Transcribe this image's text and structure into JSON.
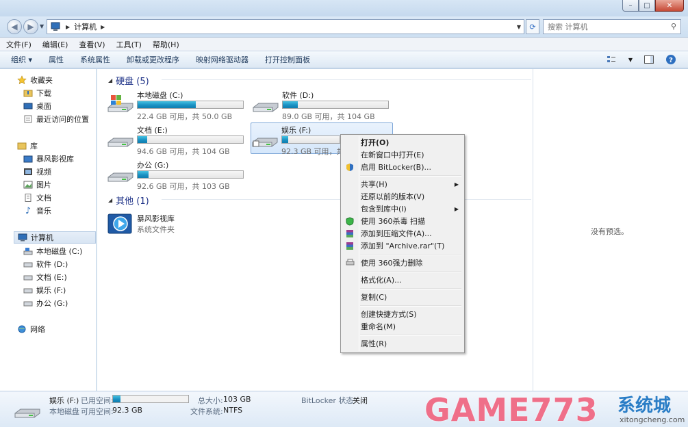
{
  "window": {
    "buttons": {
      "minimize": "–",
      "maximize": "□",
      "close": "✕"
    }
  },
  "address": {
    "crumb": "计算机",
    "search_placeholder": "搜索 计算机"
  },
  "menu": {
    "items": [
      "文件(F)",
      "编辑(E)",
      "查看(V)",
      "工具(T)",
      "帮助(H)"
    ]
  },
  "commands": {
    "organize": "组织 ▾",
    "items": [
      "属性",
      "系统属性",
      "卸载或更改程序",
      "映射网络驱动器",
      "打开控制面板"
    ]
  },
  "nav": {
    "favorites": "收藏夹",
    "favorites_items": [
      "下载",
      "桌面",
      "最近访问的位置"
    ],
    "libraries": "库",
    "library_items": [
      "暴风影视库",
      "视频",
      "图片",
      "文档",
      "音乐"
    ],
    "computer": "计算机",
    "computer_items": [
      "本地磁盘 (C:)",
      "软件 (D:)",
      "文档 (E:)",
      "娱乐 (F:)",
      "办公 (G:)"
    ],
    "network": "网络"
  },
  "content": {
    "group_drives": "硬盘 (5)",
    "group_other": "其他 (1)",
    "drives": [
      {
        "name": "本地磁盘 (C:)",
        "info": "22.4 GB 可用，共 50.0 GB",
        "used_fraction": 0.552
      },
      {
        "name": "软件 (D:)",
        "info": "89.0 GB 可用，共 104 GB",
        "used_fraction": 0.144
      },
      {
        "name": "文档 (E:)",
        "info": "94.6 GB 可用，共 104 GB",
        "used_fraction": 0.09
      },
      {
        "name": "娱乐 (F:)",
        "info": "92.3 GB 可用，共",
        "used_fraction": 0.104
      },
      {
        "name": "办公 (G:)",
        "info": "92.6 GB 可用，共 103 GB",
        "used_fraction": 0.101
      }
    ],
    "other": {
      "name": "暴风影视库",
      "desc": "系统文件夹"
    }
  },
  "context_menu": {
    "open": "打开(O)",
    "open_new": "在新窗口中打开(E)",
    "bitlocker": "启用 BitLocker(B)...",
    "share": "共享(H)",
    "restore": "还原以前的版本(V)",
    "include": "包含到库中(I)",
    "scan360": "使用 360杀毒 扫描",
    "add_archive": "添加到压缩文件(A)...",
    "add_rar": "添加到 \"Archive.rar\"(T)",
    "delete360": "使用 360强力删除",
    "format": "格式化(A)...",
    "copy": "复制(C)",
    "shortcut": "创建快捷方式(S)",
    "rename": "重命名(M)",
    "properties": "属性(R)"
  },
  "preview": {
    "empty": "没有预选。"
  },
  "details": {
    "name": "娱乐 (F:)",
    "used_label": "已用空间:",
    "type": "本地磁盘",
    "free_label": "可用空间:",
    "free_value": "92.3 GB",
    "total_label": "总大小:",
    "total_value": "103 GB",
    "fs_label": "文件系统:",
    "fs_value": "NTFS",
    "bitlocker_label": "BitLocker 状态:",
    "bitlocker_value": "关闭",
    "used_fraction": 0.104
  },
  "watermark": {
    "brand": "GAME773",
    "cn": "系统城",
    "url": "xitongcheng.com"
  }
}
